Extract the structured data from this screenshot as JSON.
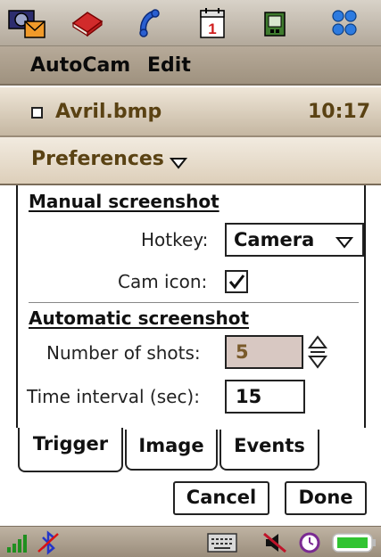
{
  "appbar": {
    "icons": [
      "camera-messaging-icon",
      "book-icon",
      "phone-icon",
      "calendar-icon",
      "media-icon",
      "apps-grid-icon"
    ],
    "calendar_day": "1"
  },
  "menu": {
    "items": [
      "AutoCam",
      "Edit"
    ]
  },
  "titlebar": {
    "filename": "Avril.bmp",
    "time": "10:17"
  },
  "prefs": {
    "title": "Preferences"
  },
  "manual": {
    "title": "Manual screenshot",
    "hotkey_label": "Hotkey:",
    "hotkey_value": "Camera",
    "camicon_label": "Cam icon:",
    "camicon_checked": true
  },
  "automatic": {
    "title": "Automatic screenshot",
    "shots_label": "Number of shots:",
    "shots_value": "5",
    "interval_label": "Time interval (sec):",
    "interval_value": "15"
  },
  "tabs": [
    {
      "label": "Trigger",
      "active": true
    },
    {
      "label": "Image",
      "active": false
    },
    {
      "label": "Events",
      "active": false
    }
  ],
  "buttons": {
    "cancel": "Cancel",
    "done": "Done"
  },
  "statusbar": {
    "icons": [
      "signal-strength-icon",
      "bluetooth-off-icon",
      "keyboard-icon",
      "no-sound-icon",
      "alarm-clock-icon",
      "battery-icon"
    ]
  },
  "colors": {
    "accent_text": "#5a4213",
    "shots_field_bg": "#d8c8c2",
    "shots_value_color": "#7a5a2a"
  }
}
